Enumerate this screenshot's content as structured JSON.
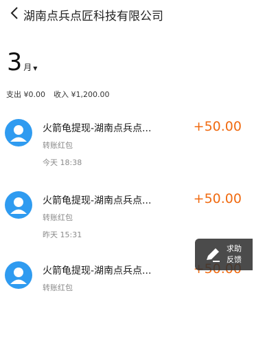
{
  "header": {
    "title": "湖南点兵点匠科技有限公司"
  },
  "month": {
    "number": "3",
    "unit": "月"
  },
  "summary": {
    "expense": "支出 ¥0.00",
    "income": "收入 ¥1,200.00"
  },
  "transactions": [
    {
      "name": "火箭龟提现-湖南点兵点...",
      "amount": "+50.00",
      "type": "转账红包",
      "time": "今天 18:38"
    },
    {
      "name": "火箭龟提现-湖南点兵点...",
      "amount": "+50.00",
      "type": "转账红包",
      "time": "昨天 15:31"
    },
    {
      "name": "火箭龟提现-湖南点兵点...",
      "amount": "+50.00",
      "type": "转账红包",
      "time": ""
    }
  ],
  "help": {
    "line1": "求助",
    "line2": "反馈"
  },
  "colors": {
    "accent_amount": "#f06a10",
    "avatar": "#2f9bf0"
  }
}
